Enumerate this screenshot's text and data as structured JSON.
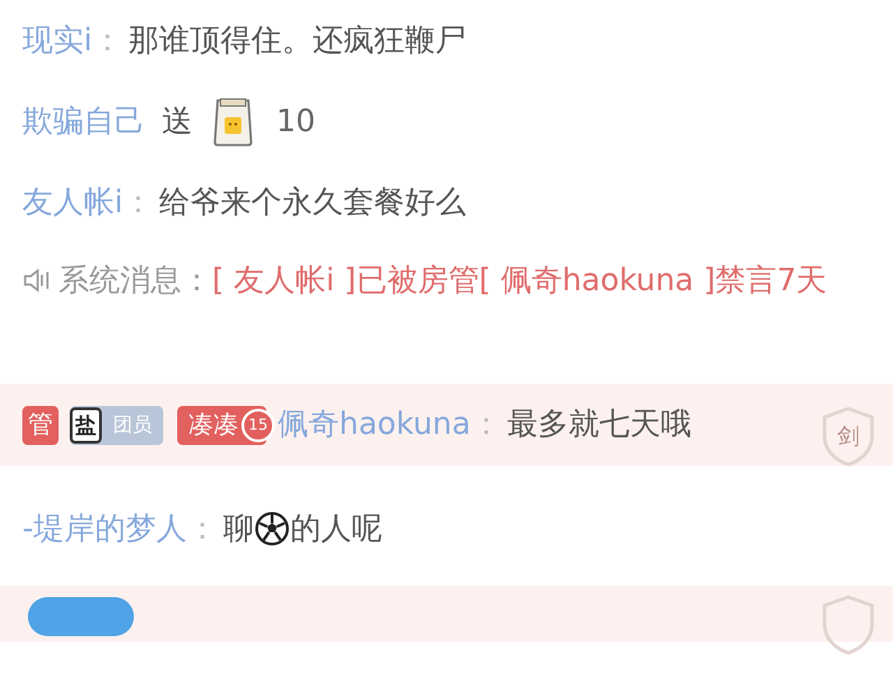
{
  "messages": [
    {
      "kind": "chat",
      "user": "现实i",
      "sep": "：",
      "segments": [
        {
          "kind": "text",
          "text": "那谁顶得住。还疯狂鞭尸"
        }
      ]
    },
    {
      "kind": "gift",
      "user": "欺骗自己",
      "verb": "送",
      "count": "10"
    },
    {
      "kind": "chat",
      "user": "友人帐i",
      "sep": "：",
      "segments": [
        {
          "kind": "text",
          "text": "给爷来个永久套餐好么"
        }
      ]
    },
    {
      "kind": "system",
      "label": "系统消息：",
      "text": "[ 友人帐i ]已被房管[ 佩奇haokuna ]禁言7天"
    },
    {
      "kind": "badged",
      "badges": [
        {
          "kind": "role",
          "text": "管"
        },
        {
          "kind": "fan",
          "icon_text": "盐",
          "text": "团员"
        },
        {
          "kind": "medal",
          "text": "凑凑",
          "level_text": "15"
        }
      ],
      "user": "佩奇haokuna",
      "sep": "：",
      "text": "最多就七天哦",
      "shield": "剑"
    },
    {
      "kind": "chat",
      "user": "-堤岸的梦人",
      "sep": "：",
      "segments": [
        {
          "kind": "text",
          "text": "聊"
        },
        {
          "kind": "emoji"
        },
        {
          "kind": "text",
          "text": "的人呢"
        }
      ]
    },
    {
      "kind": "partial"
    }
  ]
}
